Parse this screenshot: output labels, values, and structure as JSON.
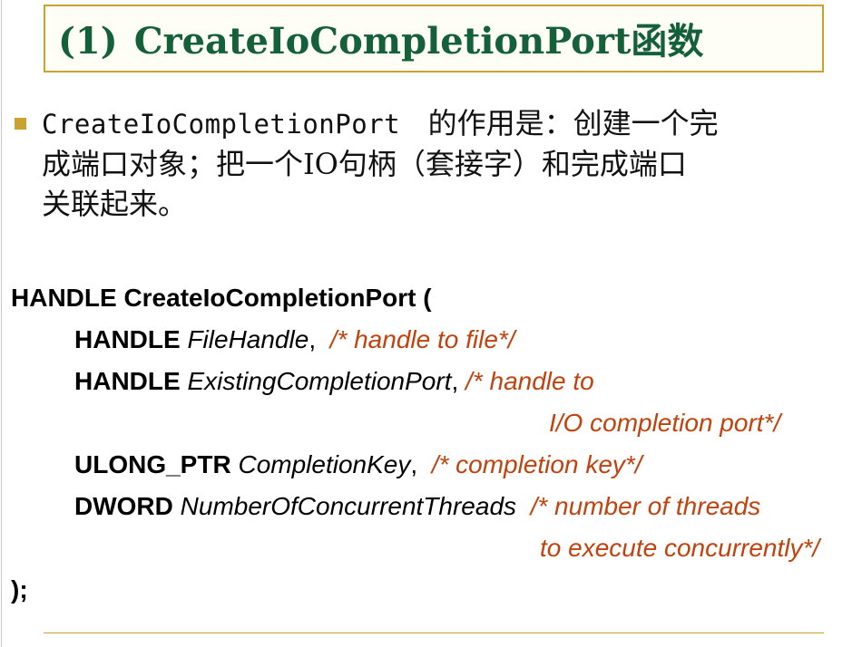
{
  "title": {
    "number": "(1)",
    "text": "CreateIoCompletionPort函数"
  },
  "bullet": {
    "line1_code": "CreateIoCompletionPort",
    "line1_rest": "的作用是：创建一个完",
    "line2": "成端口对象；把一个IO句柄（套接字）和完成端口",
    "line3": "关联起来。"
  },
  "code": {
    "signature": "HANDLE CreateIoCompletionPort (",
    "params": [
      {
        "type": "HANDLE",
        "name": "FileHandle",
        "sep": ",",
        "comment": "/* handle to file*/"
      },
      {
        "type": "HANDLE",
        "name": "ExistingCompletionPort",
        "sep": ",",
        "comment": "/* handle to",
        "comment_cont": "I/O completion port*/"
      },
      {
        "type": "ULONG_PTR",
        "name": "CompletionKey",
        "sep": ",",
        "comment": "/* completion key*/"
      },
      {
        "type": "DWORD",
        "name": "NumberOfConcurrentThreads",
        "sep": "",
        "comment": "/* number of threads",
        "comment_cont": "to execute concurrently*/"
      }
    ],
    "closing": ");"
  },
  "colors": {
    "title_green": "#14603a",
    "accent_gold": "#c9a230",
    "comment_orange": "#c2410c"
  }
}
